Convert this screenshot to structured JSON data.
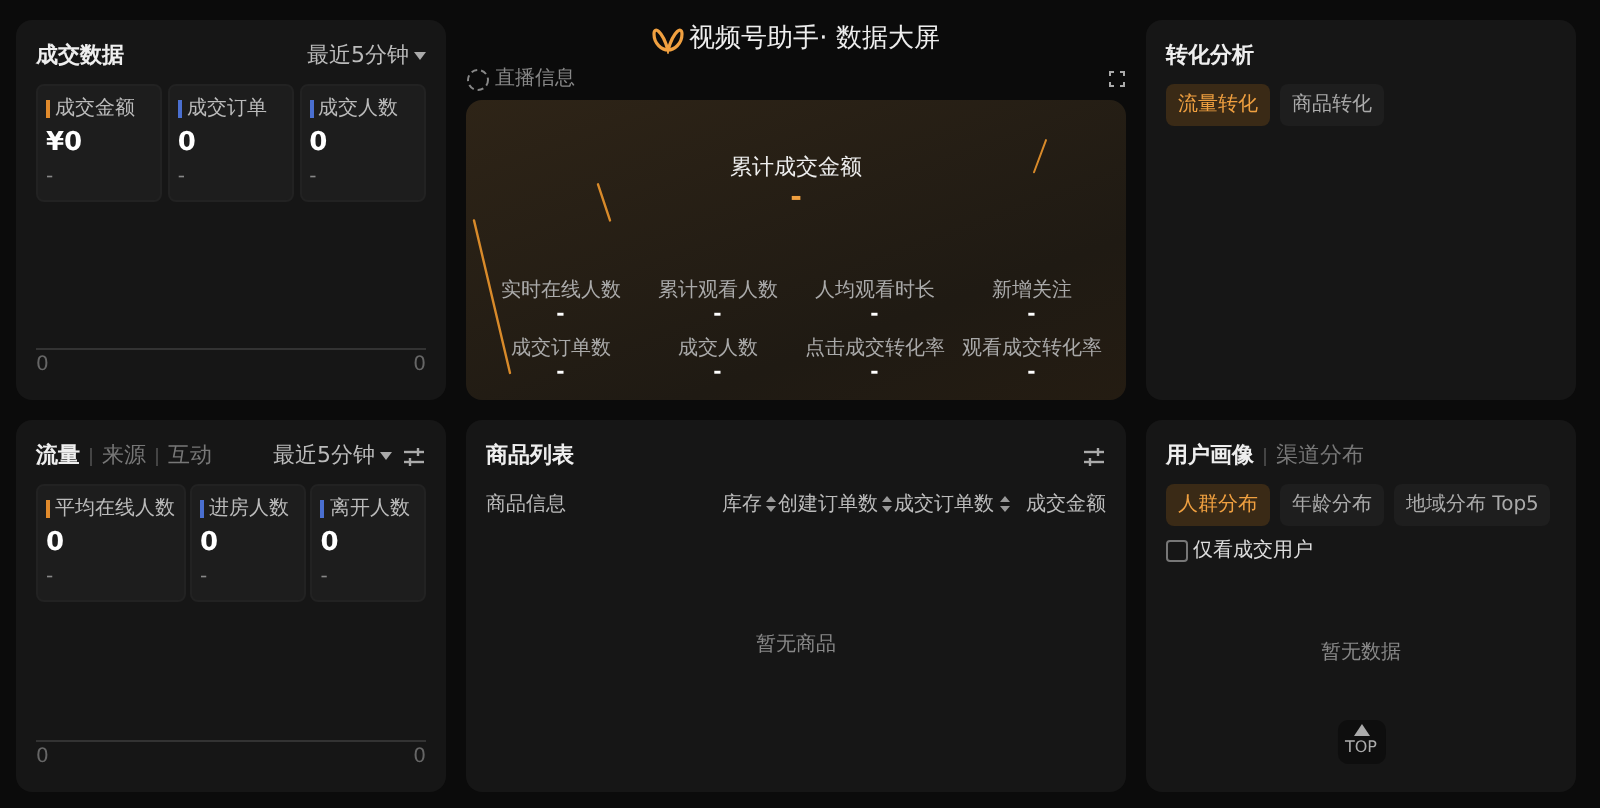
{
  "header": {
    "title": "视频号助手· 数据大屏"
  },
  "deal_panel": {
    "title": "成交数据",
    "range": "最近5分钟",
    "metrics": [
      {
        "label": "成交金额",
        "value": "¥0",
        "sub": "-",
        "color": "#e08a2c"
      },
      {
        "label": "成交订单",
        "value": "0",
        "sub": "-",
        "color": "#4a6fd0"
      },
      {
        "label": "成交人数",
        "value": "0",
        "sub": "-",
        "color": "#4a6fd0"
      }
    ],
    "axis_labels": [
      "0",
      "0"
    ]
  },
  "live_panel": {
    "label": "直播信息",
    "hero_title": "累计成交金额",
    "hero_value": "-",
    "stats": [
      {
        "label": "实时在线人数",
        "value": "-"
      },
      {
        "label": "累计观看人数",
        "value": "-"
      },
      {
        "label": "人均观看时长",
        "value": "-"
      },
      {
        "label": "新增关注",
        "value": "-"
      },
      {
        "label": "成交订单数",
        "value": "-"
      },
      {
        "label": "成交人数",
        "value": "-"
      },
      {
        "label": "点击成交转化率",
        "value": "-"
      },
      {
        "label": "观看成交转化率",
        "value": "-"
      }
    ]
  },
  "conversion_panel": {
    "title": "转化分析",
    "tabs": [
      {
        "label": "流量转化",
        "selected": true
      },
      {
        "label": "商品转化",
        "selected": false
      }
    ]
  },
  "traffic_panel": {
    "tabs": [
      {
        "label": "流量",
        "selected": true
      },
      {
        "label": "来源",
        "selected": false
      },
      {
        "label": "互动",
        "selected": false
      }
    ],
    "range": "最近5分钟",
    "metrics": [
      {
        "label": "平均在线人数",
        "value": "0",
        "sub": "-",
        "color": "#e08a2c"
      },
      {
        "label": "进房人数",
        "value": "0",
        "sub": "-",
        "color": "#4a6fd0"
      },
      {
        "label": "离开人数",
        "value": "0",
        "sub": "-",
        "color": "#4a6fd0"
      }
    ],
    "axis_labels": [
      "0",
      "0"
    ]
  },
  "product_panel": {
    "title": "商品列表",
    "columns": [
      {
        "label": "商品信息",
        "sortable": false
      },
      {
        "label": "库存",
        "sortable": true
      },
      {
        "label": "创建订单数",
        "sortable": true
      },
      {
        "label": "成交订单数",
        "sortable": true
      },
      {
        "label": "成交金额",
        "sortable": false
      }
    ],
    "empty_text": "暂无商品"
  },
  "user_panel": {
    "tabs": [
      {
        "label": "用户画像",
        "selected": true
      },
      {
        "label": "渠道分布",
        "selected": false
      }
    ],
    "filters": [
      {
        "label": "人群分布",
        "selected": true
      },
      {
        "label": "年龄分布",
        "selected": false
      },
      {
        "label": "地域分布 Top5",
        "selected": false
      }
    ],
    "checkbox": {
      "label": "仅看成交用户",
      "checked": false
    },
    "empty_text": "暂无数据",
    "top_button": "TOP"
  }
}
